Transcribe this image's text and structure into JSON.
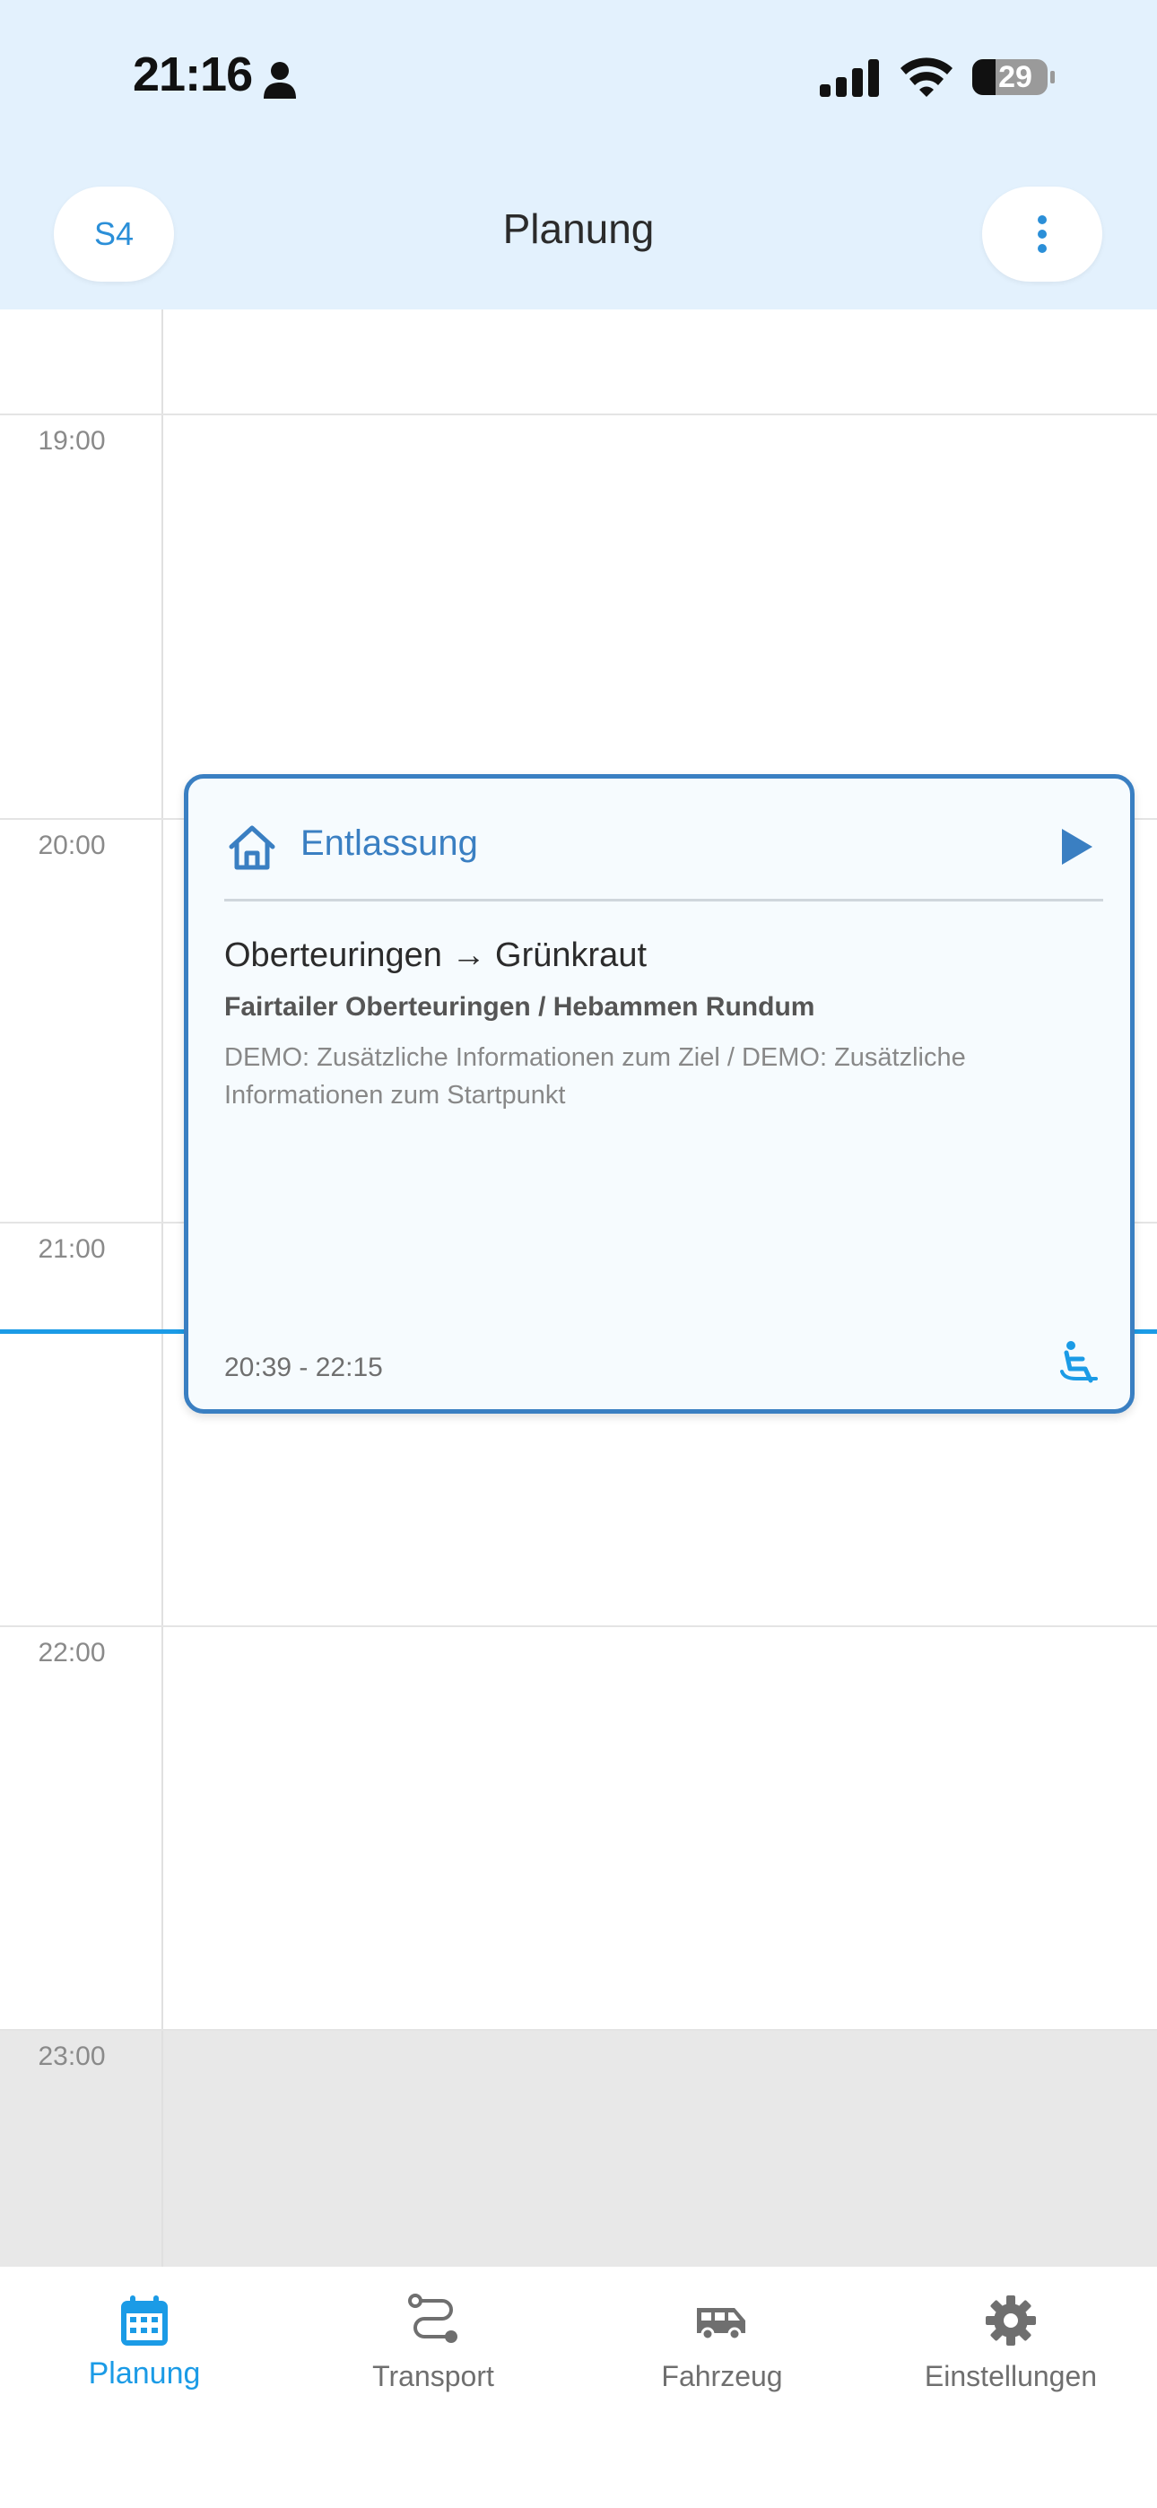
{
  "status_bar": {
    "time": "21:16",
    "battery": "29"
  },
  "header": {
    "vehicle_badge": "S4",
    "title": "Planung"
  },
  "calendar": {
    "hours": [
      "19:00",
      "20:00",
      "21:00",
      "22:00",
      "23:00"
    ]
  },
  "event": {
    "type": "Entlassung",
    "route": "Oberteuringen → Grünkraut",
    "places": "Fairtailer Oberteuringen / Hebammen Rundum",
    "info": "DEMO: Zusätzliche Informationen zum Ziel / DEMO: Zusätzliche Informationen zum Startpunkt",
    "time_range": "20:39 - 22:15"
  },
  "nav": {
    "items": [
      {
        "label": "Planung",
        "icon": "calendar-icon",
        "active": true
      },
      {
        "label": "Transport",
        "icon": "route-icon",
        "active": false
      },
      {
        "label": "Fahrzeug",
        "icon": "van-icon",
        "active": false
      },
      {
        "label": "Einstellungen",
        "icon": "gear-icon",
        "active": false
      }
    ]
  },
  "colors": {
    "header_bg": "#e3f1fd",
    "accent": "#1b9be6",
    "card_border": "#3a7fc2",
    "after_hours_bg": "#e8e8e8"
  }
}
